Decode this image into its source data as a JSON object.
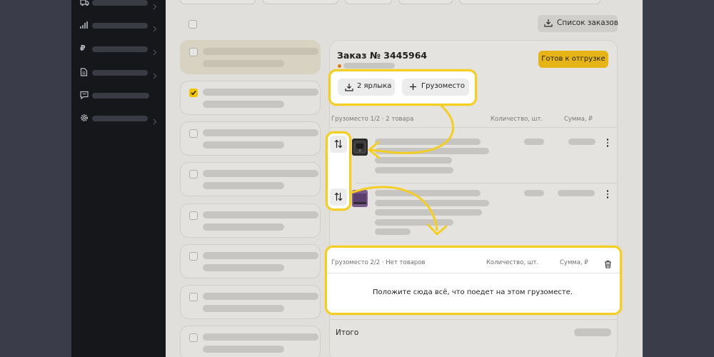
{
  "sidebar": {
    "items": [
      {
        "icon": "truck-icon"
      },
      {
        "icon": "chart-icon"
      },
      {
        "icon": "ruble-icon",
        "glyph": "₽"
      },
      {
        "icon": "document-icon"
      },
      {
        "icon": "chat-icon"
      },
      {
        "icon": "gear-icon"
      }
    ]
  },
  "toolbar": {
    "orders_list_label": "Список заказов"
  },
  "order": {
    "title": "Заказ № 3445964",
    "ready_label": "Готов к отгрузке",
    "labels_button": "2 ярлыка",
    "add_package_button": "Грузоместо",
    "package1": {
      "heading": "Грузоместо 1/2 · 2 товара",
      "qty_header": "Количество, шт.",
      "sum_header": "Сумма, ₽"
    },
    "package2": {
      "heading": "Грузоместо 2/2 · Нет товаров",
      "qty_header": "Количество, шт.",
      "sum_header": "Сумма, ₽",
      "empty_text": "Положите сюда всё, что поедет на этом грузоместе."
    },
    "total_label": "Итого"
  },
  "colors": {
    "accent": "#f4ce24",
    "ready_button": "#e6b416",
    "sidebar": "#16171b",
    "backdrop": "#3a3d49"
  }
}
